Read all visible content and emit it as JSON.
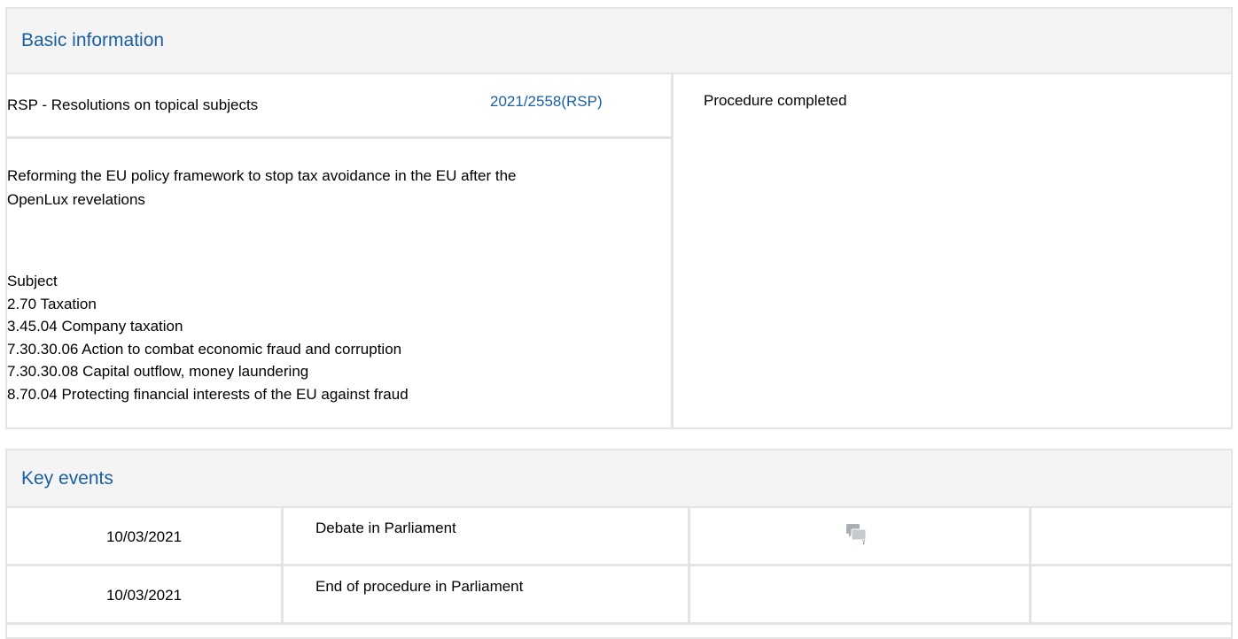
{
  "basic_information": {
    "header": "Basic information",
    "procedure_type": "RSP - Resolutions on topical subjects",
    "procedure_reference": "2021/2558(RSP)",
    "status": "Procedure completed",
    "title_line1": "Reforming the EU policy framework to stop tax avoidance in the EU after the",
    "title_line2": "OpenLux revelations",
    "subject_label": "Subject",
    "subjects": [
      "2.70 Taxation",
      "3.45.04 Company taxation",
      "7.30.30.06 Action to combat economic fraud and corruption",
      "7.30.30.08 Capital outflow, money laundering",
      "8.70.04 Protecting financial interests of the EU against fraud"
    ]
  },
  "key_events": {
    "header": "Key events",
    "rows": [
      {
        "date": "10/03/2021",
        "event": "Debate in Parliament",
        "icon": "debate-speech-bubbles-icon"
      },
      {
        "date": "10/03/2021",
        "event": "End of procedure in Parliament"
      }
    ]
  },
  "colors": {
    "accent": "#1a5fa0",
    "border": "#e4e4e4",
    "header_bg": "#f4f4f4"
  }
}
